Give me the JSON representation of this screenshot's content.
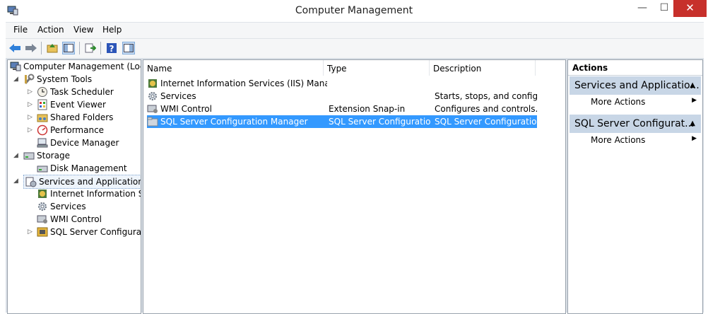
{
  "window": {
    "title": "Computer Management",
    "min": "—",
    "max": "☐",
    "close": "✕"
  },
  "menu": [
    {
      "label": "File"
    },
    {
      "label": "Action"
    },
    {
      "label": "View"
    },
    {
      "label": "Help"
    }
  ],
  "tree": {
    "root": "Computer Management (Local",
    "system_tools": "System Tools",
    "task_scheduler": "Task Scheduler",
    "event_viewer": "Event Viewer",
    "shared_folders": "Shared Folders",
    "performance": "Performance",
    "device_manager": "Device Manager",
    "storage": "Storage",
    "disk_management": "Disk Management",
    "services_apps": "Services and Applications",
    "iis": "Internet Information Ser",
    "services": "Services",
    "wmi": "WMI Control",
    "sql": "SQL Server Configuratio"
  },
  "list": {
    "headers": {
      "name": "Name",
      "type": "Type",
      "description": "Description"
    },
    "rows": [
      {
        "name": "Internet Information Services (IIS) Manager",
        "type": "",
        "description": ""
      },
      {
        "name": "Services",
        "type": "",
        "description": "Starts, stops, and config..."
      },
      {
        "name": "WMI Control",
        "type": "Extension Snap-in",
        "description": "Configures and controls..."
      },
      {
        "name": "SQL Server Configuration Manager",
        "type": "SQL Server Configuratio...",
        "description": "SQL Server Configuratio..."
      }
    ]
  },
  "actions": {
    "header": "Actions",
    "groups": [
      {
        "title": "Services and Applicatio...",
        "item": "More Actions"
      },
      {
        "title": "SQL Server Configurat...",
        "item": "More Actions"
      }
    ]
  },
  "colors": {
    "selection": "#3399ff",
    "close_button": "#c7302b",
    "action_group": "#c8d6e6"
  }
}
